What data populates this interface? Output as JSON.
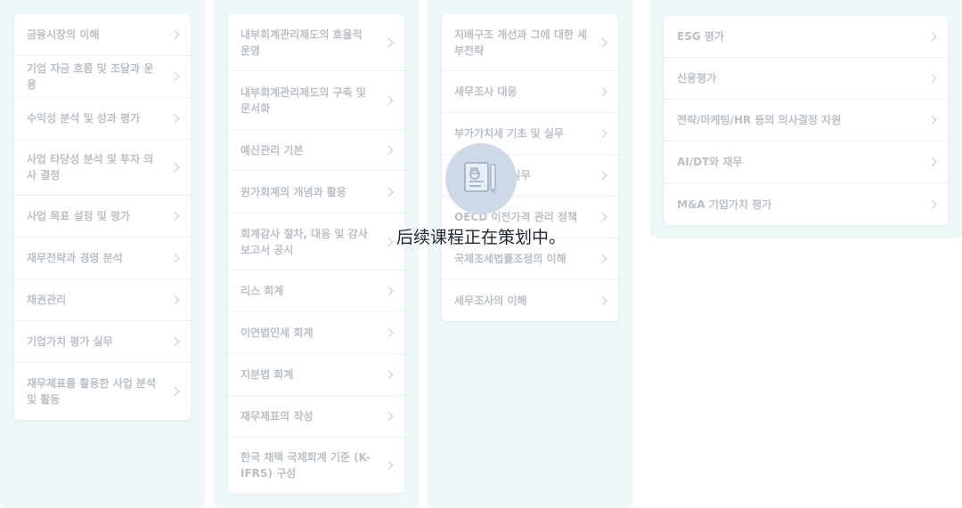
{
  "columns": [
    {
      "items": [
        {
          "label": "금융시장의 이해"
        },
        {
          "label": "기업 자금 흐름 및 조달과 운용"
        },
        {
          "label": "수익성 분석 및 성과 평가"
        },
        {
          "label": "사업 타당성 분석 및 투자 의사 결정"
        },
        {
          "label": "사업 목표 설정 및 평가"
        },
        {
          "label": "재무전략과 경영 분석"
        },
        {
          "label": "채권관리"
        },
        {
          "label": "기업가치 평가 실무"
        },
        {
          "label": "재무제표를 활용한 사업 분석 및 활동"
        }
      ]
    },
    {
      "items": [
        {
          "label": "내부회계관리제도의 효율적 운영"
        },
        {
          "label": "내부회계관리제도의 구축 및 문서화"
        },
        {
          "label": "예산관리 기본"
        },
        {
          "label": "원가회계의 개념과 활용"
        },
        {
          "label": "회계감사 절차, 대응 및 감사보고서 공시"
        },
        {
          "label": "리스 회계"
        },
        {
          "label": "이연법인세 회계"
        },
        {
          "label": "지분법 회계"
        },
        {
          "label": "재무제표의 작성"
        },
        {
          "label": "한국 채택 국제회계 기준 (K-IFRS) 구성"
        }
      ]
    },
    {
      "items": [
        {
          "label": "지배구조 개선과 그에 대한 세부전략"
        },
        {
          "label": "세무조사 대응"
        },
        {
          "label": "부가가치세 기초 및 실무"
        },
        {
          "label": "법인세 신고 실무"
        },
        {
          "label": "OECD 이전가격 관리 정책"
        },
        {
          "label": "국제조세법률조정의 이해"
        },
        {
          "label": "세무조사의 이해"
        }
      ]
    },
    {
      "items": [
        {
          "label": "ESG 평가"
        },
        {
          "label": "신용평가"
        },
        {
          "label": "전략/마케팅/HR 등의 의사결정 지원"
        },
        {
          "label": "AI/DT와 재무"
        },
        {
          "label": "M&A 기업가치 평가"
        }
      ]
    }
  ],
  "overlay": {
    "icon": "document-pencil-icon",
    "message": "后续课程正在策划中。"
  }
}
